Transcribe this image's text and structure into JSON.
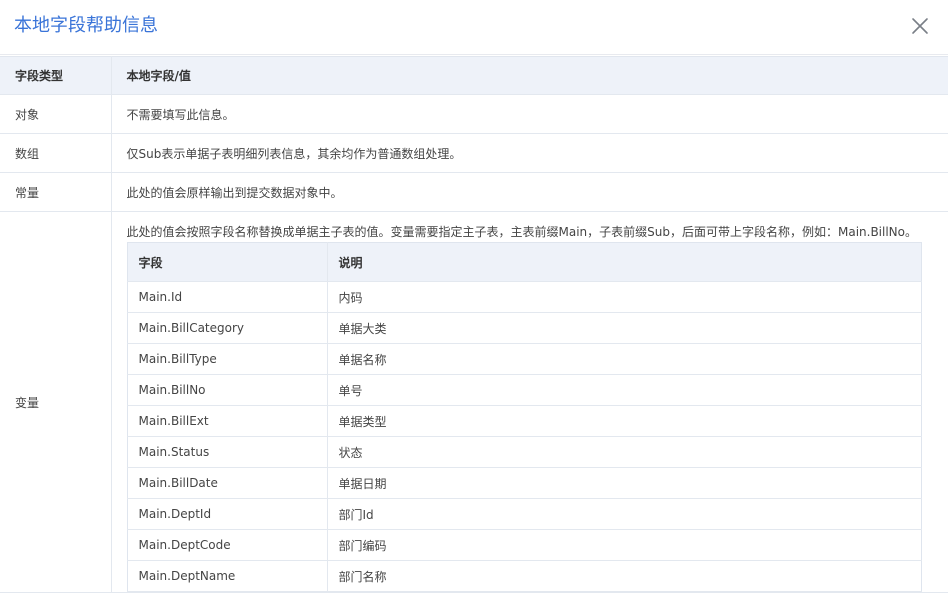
{
  "dialog": {
    "title": "本地字段帮助信息",
    "close_icon": "close-icon"
  },
  "table": {
    "headers": [
      "字段类型",
      "本地字段/值"
    ],
    "rows": [
      {
        "type": "对象",
        "desc": "不需要填写此信息。"
      },
      {
        "type": "数组",
        "desc": "仅Sub表示单据子表明细列表信息，其余均作为普通数组处理。"
      },
      {
        "type": "常量",
        "desc": "此处的值会原样输出到提交数据对象中。"
      }
    ],
    "variable": {
      "type": "变量",
      "desc": "此处的值会按照字段名称替换成单据主子表的值。变量需要指定主子表，主表前缀Main，子表前缀Sub，后面可带上字段名称，例如：Main.BillNo。",
      "sub_headers": [
        "字段",
        "说明"
      ],
      "sub_rows": [
        {
          "field": "Main.Id",
          "desc": "内码"
        },
        {
          "field": "Main.BillCategory",
          "desc": "单据大类"
        },
        {
          "field": "Main.BillType",
          "desc": "单据名称"
        },
        {
          "field": "Main.BillNo",
          "desc": "单号"
        },
        {
          "field": "Main.BillExt",
          "desc": "单据类型"
        },
        {
          "field": "Main.Status",
          "desc": "状态"
        },
        {
          "field": "Main.BillDate",
          "desc": "单据日期"
        },
        {
          "field": "Main.DeptId",
          "desc": "部门Id"
        },
        {
          "field": "Main.DeptCode",
          "desc": "部门编码"
        },
        {
          "field": "Main.DeptName",
          "desc": "部门名称"
        }
      ]
    }
  }
}
